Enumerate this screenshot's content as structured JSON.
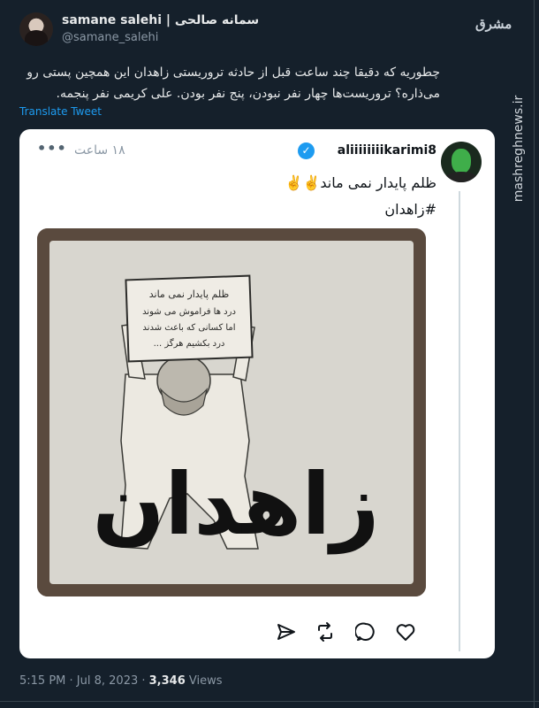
{
  "author": {
    "display_name": "samane salehi | سمانه صالحی",
    "handle": "@samane_salehi"
  },
  "tweet": {
    "text": "چطوریه که دقیقا چند ساعت قبل از حادثه تروریستی زاهدان این همچین پستی رو می‌ذاره؟ تروریست‌ها چهار نفر نبودن، پنج نفر بودن. علی کریمی نفر پنجمه.",
    "translate_label": "Translate Tweet",
    "time": "5:15 PM",
    "date": "Jul 8, 2023",
    "views_count": "3,346",
    "views_label": "Views"
  },
  "quoted": {
    "username": "aliiiiiiiikarimi8",
    "time_ago": "۱۸ ساعت",
    "more_label": "•••",
    "line1": "ظلم پایدار نمی ماند✌️✌️",
    "line2": "#زاهدان",
    "image": {
      "sign_text_1": "ظلم پایدار نمی ماند",
      "sign_text_2": "درد ها فراموش می شوند",
      "sign_text_3": "اما کسانی که باعث شدند",
      "sign_text_4": "درد بکشیم هرگز ...",
      "big_word": "زاهدان"
    }
  },
  "watermark": {
    "logo_text": "مشرق",
    "site": "mashreghnews.ir"
  },
  "colors": {
    "background": "#15202b",
    "accent": "#1d9bf0",
    "card": "#ffffff"
  }
}
